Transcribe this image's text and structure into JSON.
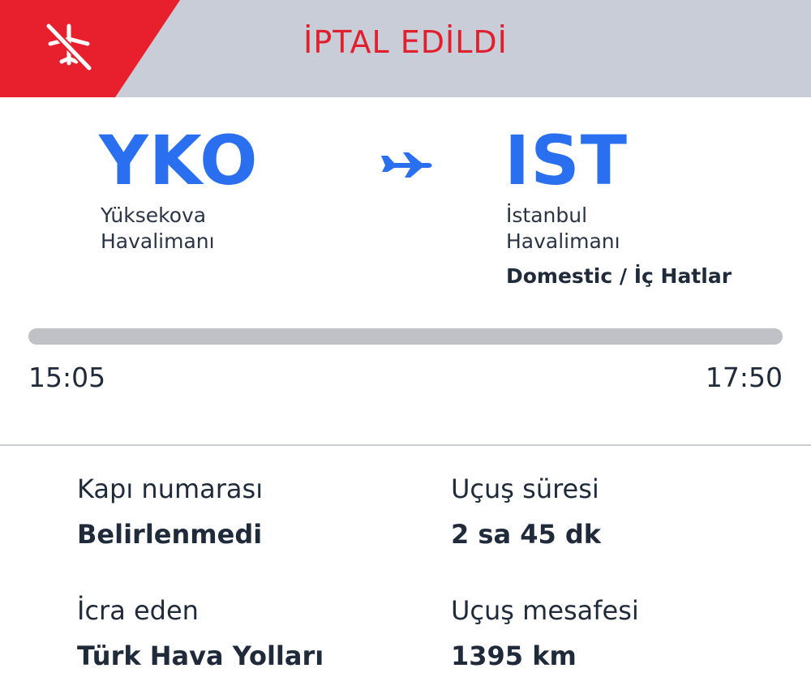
{
  "status": {
    "label": "İPTAL EDİLDİ",
    "icon": "plane-cancelled-icon",
    "color": "#e8202e",
    "banner_color": "#c8cdd7"
  },
  "route": {
    "origin": {
      "code": "YKO",
      "name_line1": "Yüksekova",
      "name_line2": "Havalimanı"
    },
    "destination": {
      "code": "IST",
      "name_line1": "İstanbul",
      "name_line2": "Havalimanı"
    },
    "flight_type": "Domestic / İç Hatlar",
    "icon": "plane-icon",
    "accent_color": "#2a6ff0"
  },
  "schedule": {
    "departure_time": "15:05",
    "arrival_time": "17:50"
  },
  "details": {
    "gate_label": "Kapı numarası",
    "gate_value": "Belirlenmedi",
    "duration_label": "Uçuş süresi",
    "duration_value": "2 sa 45 dk",
    "operator_label": "İcra eden",
    "operator_value": "Türk Hava Yolları",
    "distance_label": "Uçuş mesafesi",
    "distance_value": "1395 km"
  }
}
